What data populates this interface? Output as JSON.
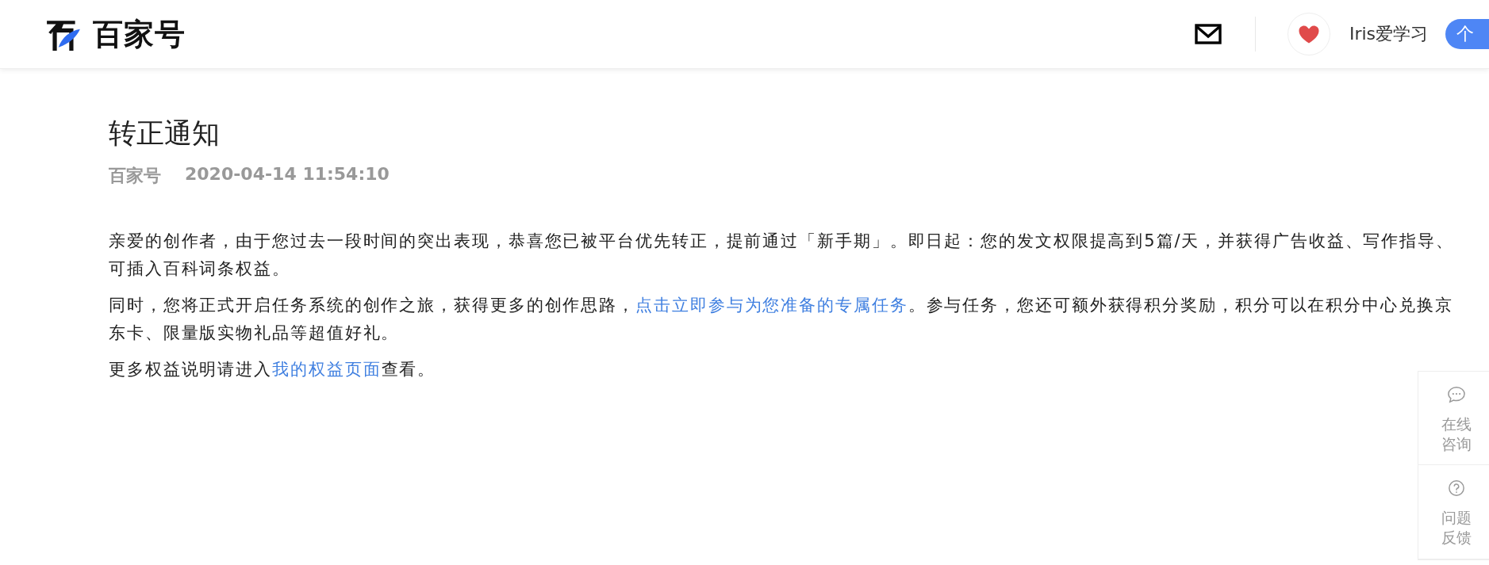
{
  "header": {
    "logo_text": "百家号",
    "user_name": "Iris爱学习",
    "cut_button": "个"
  },
  "article": {
    "title": "转正通知",
    "source": "百家号",
    "time": "2020-04-14 11:54:10",
    "paragraphs": [
      [
        {
          "text": "亲爱的创作者，由于您过去一段时间的突出表现，恭喜您已被平台优先转正，提前通过「新手期」。即日起：您的发文权限提高到5篇/天，并获得广告收益、写作指导、可插入百科词条权益。",
          "link": false
        }
      ],
      [
        {
          "text": "同时，您将正式开启任务系统的创作之旅，获得更多的创作思路，",
          "link": false
        },
        {
          "text": "点击立即参与为您准备的专属任务",
          "link": true
        },
        {
          "text": "。参与任务，您还可额外获得积分奖励，积分可以在积分中心兑换京东卡、限量版实物礼品等超值好礼。",
          "link": false
        }
      ],
      [
        {
          "text": "更多权益说明请进入",
          "link": false
        },
        {
          "text": "我的权益页面",
          "link": true
        },
        {
          "text": "查看。",
          "link": false
        }
      ]
    ]
  },
  "side_tools": [
    {
      "kind": "chat",
      "label": "在线咨询"
    },
    {
      "kind": "help",
      "label": "问题反馈"
    }
  ]
}
